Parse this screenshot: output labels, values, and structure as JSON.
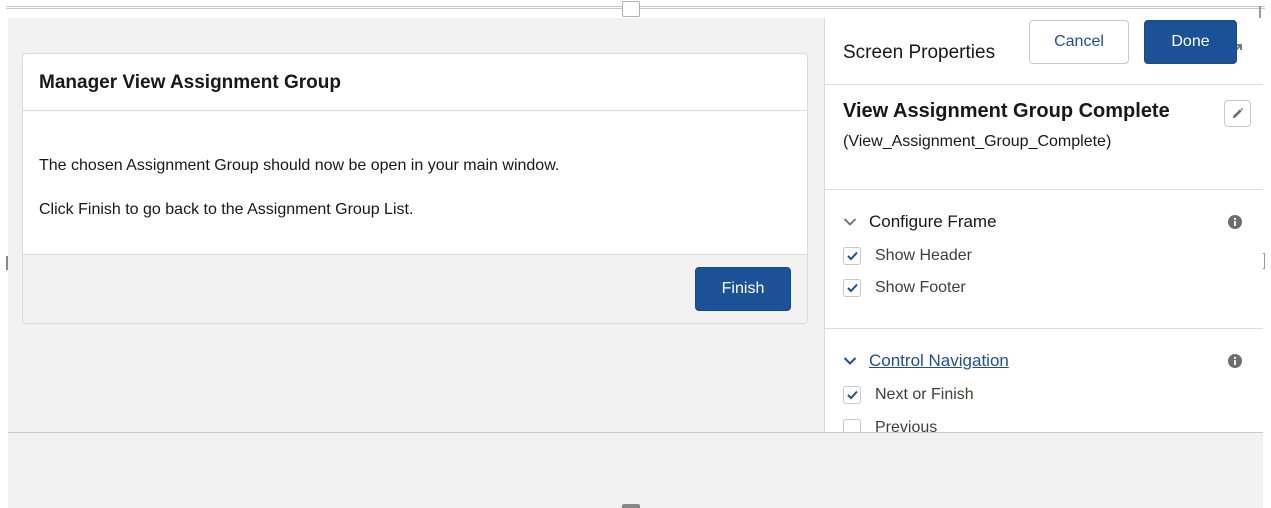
{
  "canvas": {
    "card": {
      "title": "Manager View Assignment Group",
      "body_line_1": "The chosen Assignment Group should now be open in your main window.",
      "body_line_2": "Click Finish to go back to the Assignment Group List.",
      "finish_label": "Finish"
    }
  },
  "properties_panel": {
    "title": "Screen Properties",
    "expand_icon": "expand-icon",
    "screen": {
      "label": "View Assignment Group Complete",
      "api_name": "(View_Assignment_Group_Complete)",
      "edit_icon": "pencil-icon"
    },
    "configure_frame": {
      "heading": "Configure Frame",
      "expanded": true,
      "options": [
        {
          "label": "Show Header",
          "checked": true
        },
        {
          "label": "Show Footer",
          "checked": true
        }
      ]
    },
    "control_navigation": {
      "heading": "Control Navigation",
      "expanded": true,
      "options": [
        {
          "label": "Next or Finish",
          "checked": true
        },
        {
          "label": "Previous",
          "checked": false
        }
      ]
    }
  },
  "footer": {
    "cancel_label": "Cancel",
    "done_label": "Done"
  },
  "colors": {
    "brand": "#1b5297",
    "canvas_bg": "#f3f2f2",
    "border": "#dddbda",
    "text": "#181818"
  }
}
